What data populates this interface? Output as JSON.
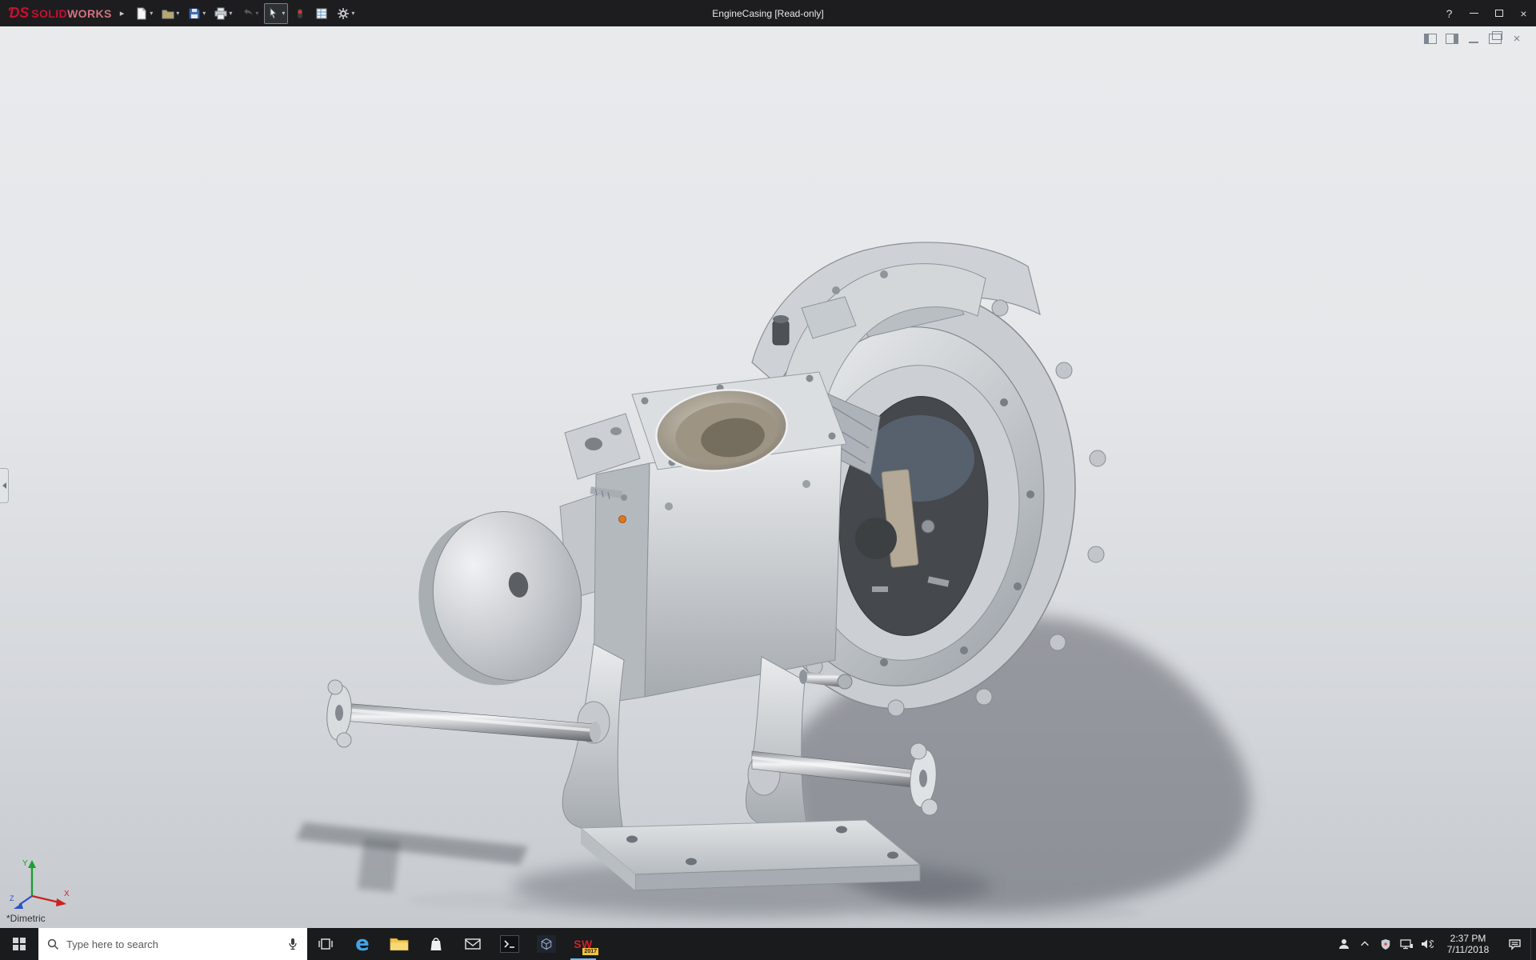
{
  "titlebar": {
    "logo": {
      "mark": "ƊS",
      "solid": "SOLID",
      "works": "WORKS"
    },
    "flyout_glyph": "▸",
    "title": "EngineCasing [Read-only]",
    "help_glyph": "?",
    "close_glyph": "×",
    "toolbar_caret_glyph": "▾",
    "toolbar_items": [
      "new-document",
      "open",
      "save",
      "print",
      "undo",
      "select",
      "rebuild",
      "file-properties",
      "options"
    ]
  },
  "document_window": {
    "controls": [
      "dock-left",
      "dock-right",
      "minimize",
      "restore",
      "close"
    ],
    "close_glyph": "×"
  },
  "viewport": {
    "view_label": "*Dimetric",
    "triad": {
      "x": "X",
      "y": "Y",
      "z": "Z"
    },
    "selection_color": "#e0761c",
    "bg_top": "#e8eaec",
    "bg_bottom": "#c6cacf"
  },
  "taskbar": {
    "search_placeholder": "Type here to search",
    "edge_letter": "e",
    "solidworks_badge": {
      "text": "SW",
      "year": "2017"
    },
    "apps": [
      "start",
      "task-view",
      "edge",
      "file-explorer",
      "store",
      "mail",
      "command-prompt",
      "3d-app",
      "solidworks-2017"
    ],
    "tray_icons": [
      "people",
      "chevron-up",
      "shield",
      "network",
      "volume"
    ],
    "clock": {
      "time": "2:37 PM",
      "date": "7/11/2018"
    }
  }
}
